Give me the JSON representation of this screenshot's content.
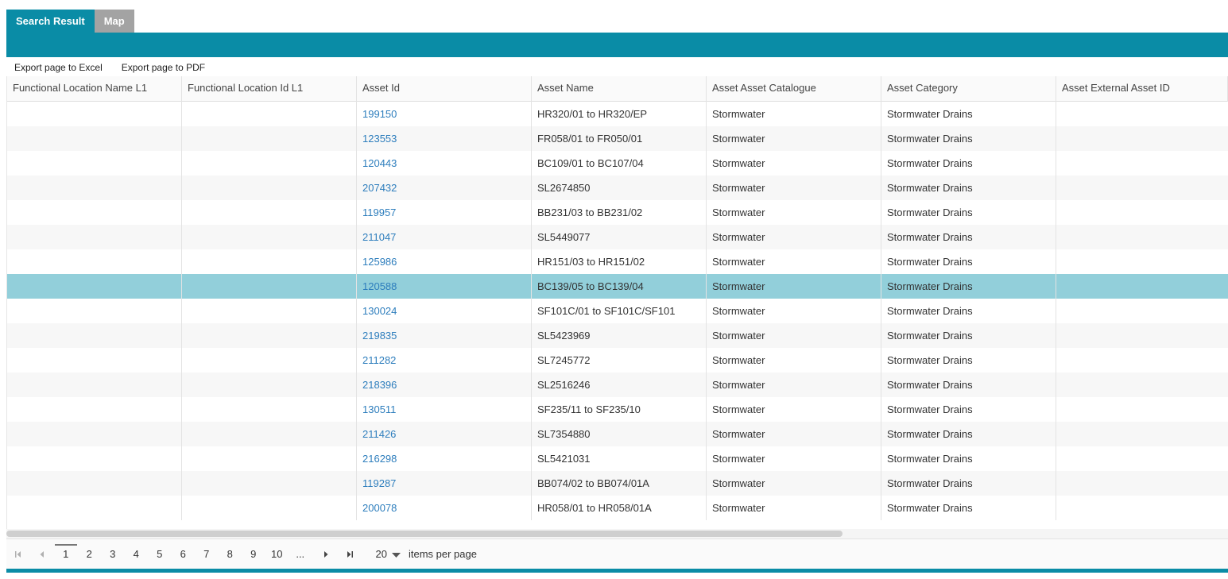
{
  "tabs": [
    {
      "label": "Search Result"
    },
    {
      "label": "Map"
    }
  ],
  "toolbar": {
    "export_excel": "Export page to Excel",
    "export_pdf": "Export page to PDF"
  },
  "grid": {
    "columns": [
      "Functional Location Name L1",
      "Functional Location Id L1",
      "Asset Id",
      "Asset Name",
      "Asset Asset Catalogue",
      "Asset Category",
      "Asset External Asset ID"
    ],
    "rows": [
      {
        "fl_name": "",
        "fl_id": "",
        "asset_id": "199150",
        "asset_name": "HR320/01 to HR320/EP",
        "catalogue": "Stormwater",
        "category": "Stormwater Drains",
        "external_id": ""
      },
      {
        "fl_name": "",
        "fl_id": "",
        "asset_id": "123553",
        "asset_name": "FR058/01 to FR050/01",
        "catalogue": "Stormwater",
        "category": "Stormwater Drains",
        "external_id": ""
      },
      {
        "fl_name": "",
        "fl_id": "",
        "asset_id": "120443",
        "asset_name": "BC109/01 to BC107/04",
        "catalogue": "Stormwater",
        "category": "Stormwater Drains",
        "external_id": ""
      },
      {
        "fl_name": "",
        "fl_id": "",
        "asset_id": "207432",
        "asset_name": "SL2674850",
        "catalogue": "Stormwater",
        "category": "Stormwater Drains",
        "external_id": ""
      },
      {
        "fl_name": "",
        "fl_id": "",
        "asset_id": "119957",
        "asset_name": "BB231/03 to BB231/02",
        "catalogue": "Stormwater",
        "category": "Stormwater Drains",
        "external_id": ""
      },
      {
        "fl_name": "",
        "fl_id": "",
        "asset_id": "211047",
        "asset_name": "SL5449077",
        "catalogue": "Stormwater",
        "category": "Stormwater Drains",
        "external_id": ""
      },
      {
        "fl_name": "",
        "fl_id": "",
        "asset_id": "125986",
        "asset_name": "HR151/03 to HR151/02",
        "catalogue": "Stormwater",
        "category": "Stormwater Drains",
        "external_id": ""
      },
      {
        "fl_name": "",
        "fl_id": "",
        "asset_id": "120588",
        "asset_name": "BC139/05 to BC139/04",
        "catalogue": "Stormwater",
        "category": "Stormwater Drains",
        "external_id": "",
        "selected": true
      },
      {
        "fl_name": "",
        "fl_id": "",
        "asset_id": "130024",
        "asset_name": "SF101C/01 to SF101C/SF101",
        "catalogue": "Stormwater",
        "category": "Stormwater Drains",
        "external_id": ""
      },
      {
        "fl_name": "",
        "fl_id": "",
        "asset_id": "219835",
        "asset_name": "SL5423969",
        "catalogue": "Stormwater",
        "category": "Stormwater Drains",
        "external_id": ""
      },
      {
        "fl_name": "",
        "fl_id": "",
        "asset_id": "211282",
        "asset_name": "SL7245772",
        "catalogue": "Stormwater",
        "category": "Stormwater Drains",
        "external_id": ""
      },
      {
        "fl_name": "",
        "fl_id": "",
        "asset_id": "218396",
        "asset_name": "SL2516246",
        "catalogue": "Stormwater",
        "category": "Stormwater Drains",
        "external_id": ""
      },
      {
        "fl_name": "",
        "fl_id": "",
        "asset_id": "130511",
        "asset_name": "SF235/11 to SF235/10",
        "catalogue": "Stormwater",
        "category": "Stormwater Drains",
        "external_id": ""
      },
      {
        "fl_name": "",
        "fl_id": "",
        "asset_id": "211426",
        "asset_name": "SL7354880",
        "catalogue": "Stormwater",
        "category": "Stormwater Drains",
        "external_id": ""
      },
      {
        "fl_name": "",
        "fl_id": "",
        "asset_id": "216298",
        "asset_name": "SL5421031",
        "catalogue": "Stormwater",
        "category": "Stormwater Drains",
        "external_id": ""
      },
      {
        "fl_name": "",
        "fl_id": "",
        "asset_id": "119287",
        "asset_name": "BB074/02 to BB074/01A",
        "catalogue": "Stormwater",
        "category": "Stormwater Drains",
        "external_id": ""
      },
      {
        "fl_name": "",
        "fl_id": "",
        "asset_id": "200078",
        "asset_name": "HR058/01 to HR058/01A",
        "catalogue": "Stormwater",
        "category": "Stormwater Drains",
        "external_id": ""
      }
    ]
  },
  "pager": {
    "pages": [
      "1",
      "2",
      "3",
      "4",
      "5",
      "6",
      "7",
      "8",
      "9",
      "10",
      "..."
    ],
    "current_page": "1",
    "page_size": "20",
    "page_size_label": "items per page"
  },
  "colors": {
    "accent": "#0a8ca6",
    "inactive_tab": "#a3a3a3",
    "selected_row": "#92cfda",
    "link": "#2e7ebd"
  }
}
